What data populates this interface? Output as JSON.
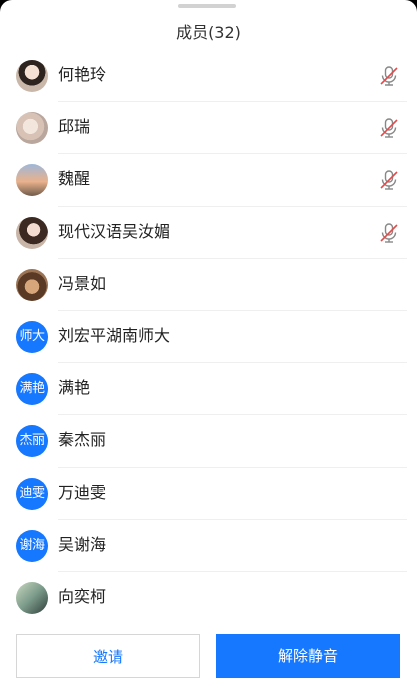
{
  "header": {
    "title": "成员(32)"
  },
  "members": [
    {
      "name": "何艳玲",
      "avatar_text": "",
      "muted": true
    },
    {
      "name": "邱瑞",
      "avatar_text": "",
      "muted": true
    },
    {
      "name": "魏醒",
      "avatar_text": "",
      "muted": true
    },
    {
      "name": "现代汉语吴汝媚",
      "avatar_text": "",
      "muted": true
    },
    {
      "name": "冯景如",
      "avatar_text": "",
      "muted": false
    },
    {
      "name": "刘宏平湖南师大",
      "avatar_text": "师大",
      "muted": false
    },
    {
      "name": "满艳",
      "avatar_text": "满艳",
      "muted": false
    },
    {
      "name": "秦杰丽",
      "avatar_text": "杰丽",
      "muted": false
    },
    {
      "name": "万迪雯",
      "avatar_text": "迪雯",
      "muted": false
    },
    {
      "name": "吴谢海",
      "avatar_text": "谢海",
      "muted": false
    },
    {
      "name": "向奕柯",
      "avatar_text": "",
      "muted": false
    }
  ],
  "footer": {
    "invite_label": "邀请",
    "unmute_all_label": "解除静音"
  },
  "colors": {
    "accent": "#1677ff",
    "muted_mic": "#e24b4b"
  },
  "icons": {
    "muted": "mic-muted-icon"
  }
}
